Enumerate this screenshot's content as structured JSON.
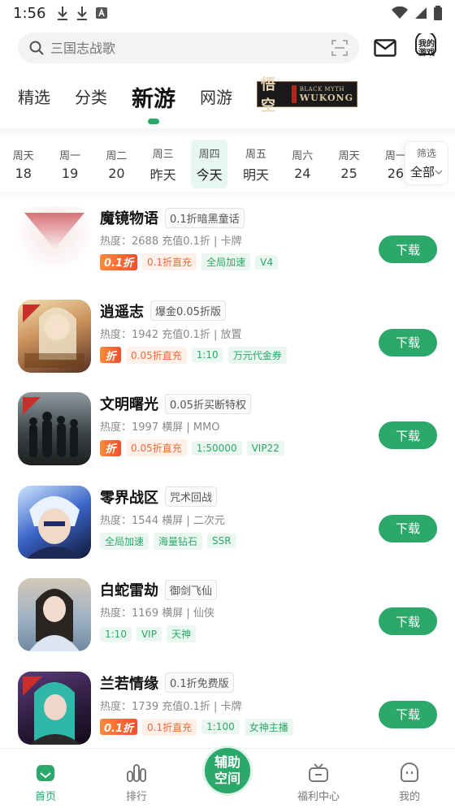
{
  "status_bar": {
    "time": "1:56"
  },
  "search": {
    "placeholder": "三国志战歌"
  },
  "header": {
    "my_game_label": "我的游戏"
  },
  "category_tabs": [
    {
      "label": "精选"
    },
    {
      "label": "分类"
    },
    {
      "label": "新游",
      "active": true
    },
    {
      "label": "网游"
    }
  ],
  "banner": {
    "glyph": "悟空",
    "line1": "BLACK MYTH",
    "line2": "WUKONG"
  },
  "days": [
    {
      "weekday": "周天",
      "date": "18"
    },
    {
      "weekday": "周一",
      "date": "19"
    },
    {
      "weekday": "周二",
      "date": "20"
    },
    {
      "weekday": "周三",
      "date": "昨天"
    },
    {
      "weekday": "周四",
      "date": "今天",
      "active": true
    },
    {
      "weekday": "周五",
      "date": "明天"
    },
    {
      "weekday": "周六",
      "date": "24"
    },
    {
      "weekday": "周天",
      "date": "25"
    },
    {
      "weekday": "周一",
      "date": "26"
    }
  ],
  "filter": {
    "label": "筛选",
    "value": "全部"
  },
  "games": [
    {
      "name": "魔镜物语",
      "subtitle": "0.1折暗黑童话",
      "meta": "热度：2688  充值0.1折 | 卡牌",
      "badge": "0.1折",
      "tags": [
        {
          "text": "0.1折直充",
          "style": "orange"
        },
        {
          "text": "全局加速",
          "style": "green"
        },
        {
          "text": "V4",
          "style": "green"
        }
      ],
      "button": "下载"
    },
    {
      "name": "逍遥志",
      "subtitle": "爆金0.05折版",
      "meta": "热度：1942  充值0.1折 | 放置",
      "badge": "折",
      "tags": [
        {
          "text": "0.05折直充",
          "style": "orange"
        },
        {
          "text": "1:10",
          "style": "green"
        },
        {
          "text": "万元代金券",
          "style": "green"
        }
      ],
      "button": "下载"
    },
    {
      "name": "文明曙光",
      "subtitle": "0.05折买断特权",
      "meta": "热度：1997  横屏 | MMO",
      "badge": "折",
      "tags": [
        {
          "text": "0.05折直充",
          "style": "orange"
        },
        {
          "text": "1:50000",
          "style": "green"
        },
        {
          "text": "VIP22",
          "style": "green"
        }
      ],
      "button": "下载"
    },
    {
      "name": "零界战区",
      "subtitle": "咒术回战",
      "meta": "热度：1544  横屏 | 二次元",
      "badge": "",
      "tags": [
        {
          "text": "全局加速",
          "style": "green"
        },
        {
          "text": "海量钻石",
          "style": "green"
        },
        {
          "text": "SSR",
          "style": "green"
        }
      ],
      "button": "下载"
    },
    {
      "name": "白蛇雷劫",
      "subtitle": "御剑飞仙",
      "meta": "热度：1169  横屏 | 仙侠",
      "badge": "",
      "tags": [
        {
          "text": "1:10",
          "style": "green"
        },
        {
          "text": "VIP",
          "style": "green"
        },
        {
          "text": "天神",
          "style": "green"
        }
      ],
      "button": "下载"
    },
    {
      "name": "兰若情缘",
      "subtitle": "0.1折免费版",
      "meta": "热度：1739  充值0.1折 | 卡牌",
      "badge": "0.1折",
      "tags": [
        {
          "text": "0.1折直充",
          "style": "orange"
        },
        {
          "text": "1:100",
          "style": "green"
        },
        {
          "text": "女神主播",
          "style": "green"
        }
      ],
      "button": "下载"
    }
  ],
  "bottom_nav": [
    {
      "label": "首页",
      "active": true
    },
    {
      "label": "排行"
    },
    {
      "label": ""
    },
    {
      "label": "福利中心"
    },
    {
      "label": "我的"
    }
  ],
  "center_button": {
    "line1": "辅助",
    "line2": "空间"
  },
  "colors": {
    "accent": "#2ca86a",
    "orange": "#f26b3a"
  }
}
